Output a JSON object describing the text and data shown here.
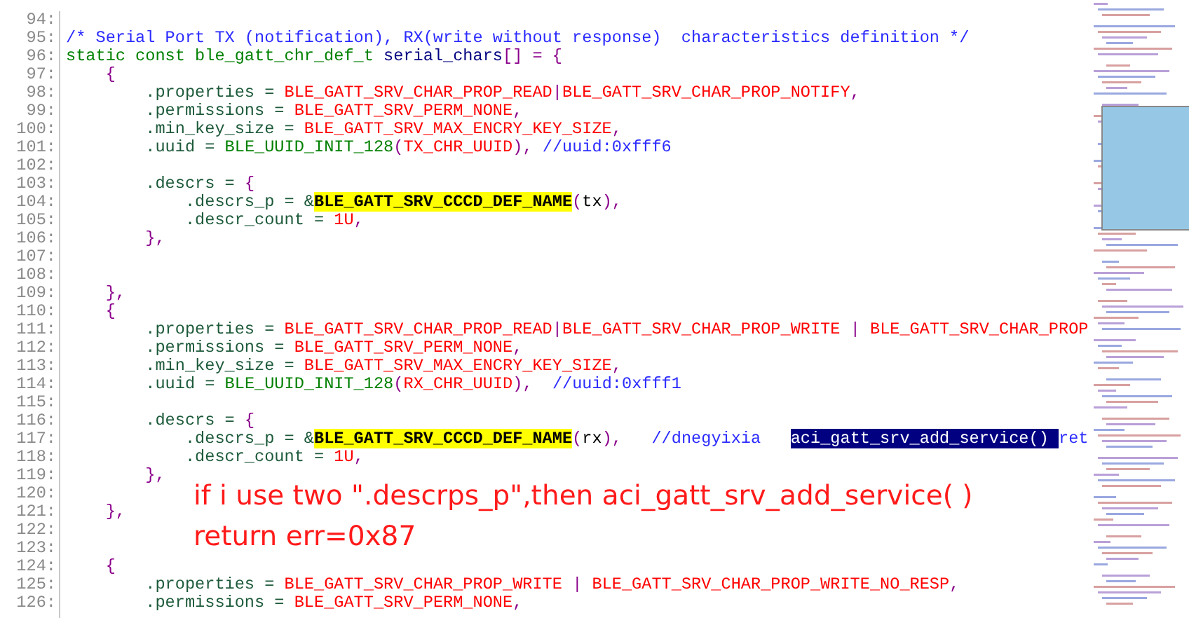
{
  "editor": {
    "lines": [
      {
        "number": "94:"
      },
      {
        "number": "95:",
        "tokens": [
          {
            "kind": "comment",
            "text": "/* Serial Port TX (notification), RX(write without response)  characteristics definition */"
          }
        ]
      },
      {
        "number": "96:",
        "tokens": [
          {
            "kind": "keyword",
            "text": "static const ble_gatt_chr_def_t "
          },
          {
            "kind": "ident",
            "text": "serial_chars"
          },
          {
            "kind": "punct",
            "text": "[] = {"
          }
        ]
      },
      {
        "number": "97:",
        "tokens": [
          {
            "kind": "punct",
            "text": "    {"
          }
        ]
      },
      {
        "number": "98:",
        "tokens": [
          {
            "kind": "member",
            "text": "        .properties = "
          },
          {
            "kind": "macro",
            "text": "BLE_GATT_SRV_CHAR_PROP_READ"
          },
          {
            "kind": "punct",
            "text": "|"
          },
          {
            "kind": "macro",
            "text": "BLE_GATT_SRV_CHAR_PROP_NOTIFY"
          },
          {
            "kind": "punct",
            "text": ","
          }
        ]
      },
      {
        "number": "99:",
        "tokens": [
          {
            "kind": "member",
            "text": "        .permissions = "
          },
          {
            "kind": "macro",
            "text": "BLE_GATT_SRV_PERM_NONE"
          },
          {
            "kind": "punct",
            "text": ","
          }
        ]
      },
      {
        "number": "100:",
        "tokens": [
          {
            "kind": "member",
            "text": "        .min_key_size = "
          },
          {
            "kind": "macro",
            "text": "BLE_GATT_SRV_MAX_ENCRY_KEY_SIZE"
          },
          {
            "kind": "punct",
            "text": ","
          }
        ]
      },
      {
        "number": "101:",
        "tokens": [
          {
            "kind": "member",
            "text": "        .uuid = "
          },
          {
            "kind": "keyword",
            "text": "BLE_UUID_INIT_128"
          },
          {
            "kind": "punct",
            "text": "("
          },
          {
            "kind": "macro",
            "text": "TX_CHR_UUID"
          },
          {
            "kind": "punct",
            "text": "),"
          },
          {
            "kind": "comment",
            "text": " //uuid:0xfff6"
          }
        ]
      },
      {
        "number": "102:"
      },
      {
        "number": "103:",
        "tokens": [
          {
            "kind": "member",
            "text": "        .descrs = "
          },
          {
            "kind": "punct",
            "text": "{"
          }
        ]
      },
      {
        "number": "104:",
        "tokens": [
          {
            "kind": "member",
            "text": "            .descrs_p = &"
          },
          {
            "kind": "highlight",
            "text": "BLE_GATT_SRV_CCCD_DEF_NAME"
          },
          {
            "kind": "punct",
            "text": "("
          },
          {
            "kind": "plain",
            "text": "tx"
          },
          {
            "kind": "punct",
            "text": "),"
          }
        ]
      },
      {
        "number": "105:",
        "tokens": [
          {
            "kind": "member",
            "text": "            .descr_count = "
          },
          {
            "kind": "number",
            "text": "1U"
          },
          {
            "kind": "punct",
            "text": ","
          }
        ]
      },
      {
        "number": "106:",
        "tokens": [
          {
            "kind": "punct",
            "text": "        },"
          }
        ]
      },
      {
        "number": "107:"
      },
      {
        "number": "108:"
      },
      {
        "number": "109:",
        "tokens": [
          {
            "kind": "punct",
            "text": "    },"
          }
        ]
      },
      {
        "number": "110:",
        "tokens": [
          {
            "kind": "punct",
            "text": "    {"
          }
        ]
      },
      {
        "number": "111:",
        "tokens": [
          {
            "kind": "member",
            "text": "        .properties = "
          },
          {
            "kind": "macro",
            "text": "BLE_GATT_SRV_CHAR_PROP_READ"
          },
          {
            "kind": "punct",
            "text": "|"
          },
          {
            "kind": "macro",
            "text": "BLE_GATT_SRV_CHAR_PROP_WRITE"
          },
          {
            "kind": "punct",
            "text": " | "
          },
          {
            "kind": "macro",
            "text": "BLE_GATT_SRV_CHAR_PROP"
          }
        ]
      },
      {
        "number": "112:",
        "tokens": [
          {
            "kind": "member",
            "text": "        .permissions = "
          },
          {
            "kind": "macro",
            "text": "BLE_GATT_SRV_PERM_NONE"
          },
          {
            "kind": "punct",
            "text": ","
          }
        ]
      },
      {
        "number": "113:",
        "tokens": [
          {
            "kind": "member",
            "text": "        .min_key_size = "
          },
          {
            "kind": "macro",
            "text": "BLE_GATT_SRV_MAX_ENCRY_KEY_SIZE"
          },
          {
            "kind": "punct",
            "text": ","
          }
        ]
      },
      {
        "number": "114:",
        "tokens": [
          {
            "kind": "member",
            "text": "        .uuid = "
          },
          {
            "kind": "keyword",
            "text": "BLE_UUID_INIT_128"
          },
          {
            "kind": "punct",
            "text": "("
          },
          {
            "kind": "macro",
            "text": "RX_CHR_UUID"
          },
          {
            "kind": "punct",
            "text": "),"
          },
          {
            "kind": "comment",
            "text": "  //uuid:0xfff1"
          }
        ]
      },
      {
        "number": "115:"
      },
      {
        "number": "116:",
        "tokens": [
          {
            "kind": "member",
            "text": "        .descrs = "
          },
          {
            "kind": "punct",
            "text": "{"
          }
        ]
      },
      {
        "number": "117:",
        "tokens": [
          {
            "kind": "member",
            "text": "            .descrs_p = &"
          },
          {
            "kind": "highlight",
            "text": "BLE_GATT_SRV_CCCD_DEF_NAME"
          },
          {
            "kind": "punct",
            "text": "("
          },
          {
            "kind": "plain",
            "text": "rx"
          },
          {
            "kind": "punct",
            "text": "),"
          },
          {
            "kind": "comment",
            "text": "   //dnegyixia   "
          },
          {
            "kind": "selected",
            "text": "aci_gatt_srv_add_service() "
          },
          {
            "kind": "comment",
            "text": "ret"
          }
        ]
      },
      {
        "number": "118:",
        "tokens": [
          {
            "kind": "member",
            "text": "            .descr_count = "
          },
          {
            "kind": "number",
            "text": "1U"
          },
          {
            "kind": "punct",
            "text": ","
          }
        ]
      },
      {
        "number": "119:",
        "tokens": [
          {
            "kind": "punct",
            "text": "        },"
          }
        ]
      },
      {
        "number": "120:"
      },
      {
        "number": "121:",
        "tokens": [
          {
            "kind": "punct",
            "text": "    },"
          }
        ]
      },
      {
        "number": "122:"
      },
      {
        "number": "123:"
      },
      {
        "number": "124:",
        "tokens": [
          {
            "kind": "punct",
            "text": "    {"
          }
        ]
      },
      {
        "number": "125:",
        "tokens": [
          {
            "kind": "member",
            "text": "        .properties = "
          },
          {
            "kind": "macro",
            "text": "BLE_GATT_SRV_CHAR_PROP_WRITE"
          },
          {
            "kind": "punct",
            "text": " | "
          },
          {
            "kind": "macro",
            "text": "BLE_GATT_SRV_CHAR_PROP_WRITE_NO_RESP"
          },
          {
            "kind": "punct",
            "text": ","
          }
        ]
      },
      {
        "number": "126:",
        "tokens": [
          {
            "kind": "member",
            "text": "        .permissions = "
          },
          {
            "kind": "macro",
            "text": "BLE_GATT_SRV_PERM_NONE"
          },
          {
            "kind": "punct",
            "text": ","
          }
        ]
      }
    ]
  },
  "annotation": [
    "if i use two \".descrps_p\",then aci_gatt_srv_add_service( )",
    "return err=0x87"
  ]
}
